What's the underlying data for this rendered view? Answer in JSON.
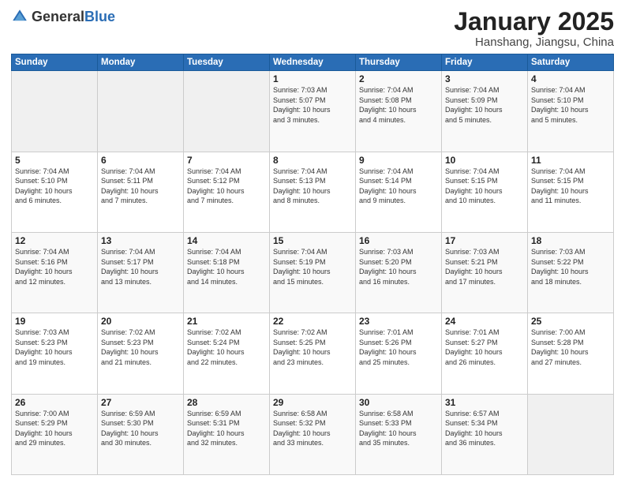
{
  "header": {
    "logo_general": "General",
    "logo_blue": "Blue",
    "month_title": "January 2025",
    "location": "Hanshang, Jiangsu, China"
  },
  "days_of_week": [
    "Sunday",
    "Monday",
    "Tuesday",
    "Wednesday",
    "Thursday",
    "Friday",
    "Saturday"
  ],
  "weeks": [
    [
      {
        "num": "",
        "info": ""
      },
      {
        "num": "",
        "info": ""
      },
      {
        "num": "",
        "info": ""
      },
      {
        "num": "1",
        "info": "Sunrise: 7:03 AM\nSunset: 5:07 PM\nDaylight: 10 hours\nand 3 minutes."
      },
      {
        "num": "2",
        "info": "Sunrise: 7:04 AM\nSunset: 5:08 PM\nDaylight: 10 hours\nand 4 minutes."
      },
      {
        "num": "3",
        "info": "Sunrise: 7:04 AM\nSunset: 5:09 PM\nDaylight: 10 hours\nand 5 minutes."
      },
      {
        "num": "4",
        "info": "Sunrise: 7:04 AM\nSunset: 5:10 PM\nDaylight: 10 hours\nand 5 minutes."
      }
    ],
    [
      {
        "num": "5",
        "info": "Sunrise: 7:04 AM\nSunset: 5:10 PM\nDaylight: 10 hours\nand 6 minutes."
      },
      {
        "num": "6",
        "info": "Sunrise: 7:04 AM\nSunset: 5:11 PM\nDaylight: 10 hours\nand 7 minutes."
      },
      {
        "num": "7",
        "info": "Sunrise: 7:04 AM\nSunset: 5:12 PM\nDaylight: 10 hours\nand 7 minutes."
      },
      {
        "num": "8",
        "info": "Sunrise: 7:04 AM\nSunset: 5:13 PM\nDaylight: 10 hours\nand 8 minutes."
      },
      {
        "num": "9",
        "info": "Sunrise: 7:04 AM\nSunset: 5:14 PM\nDaylight: 10 hours\nand 9 minutes."
      },
      {
        "num": "10",
        "info": "Sunrise: 7:04 AM\nSunset: 5:15 PM\nDaylight: 10 hours\nand 10 minutes."
      },
      {
        "num": "11",
        "info": "Sunrise: 7:04 AM\nSunset: 5:15 PM\nDaylight: 10 hours\nand 11 minutes."
      }
    ],
    [
      {
        "num": "12",
        "info": "Sunrise: 7:04 AM\nSunset: 5:16 PM\nDaylight: 10 hours\nand 12 minutes."
      },
      {
        "num": "13",
        "info": "Sunrise: 7:04 AM\nSunset: 5:17 PM\nDaylight: 10 hours\nand 13 minutes."
      },
      {
        "num": "14",
        "info": "Sunrise: 7:04 AM\nSunset: 5:18 PM\nDaylight: 10 hours\nand 14 minutes."
      },
      {
        "num": "15",
        "info": "Sunrise: 7:04 AM\nSunset: 5:19 PM\nDaylight: 10 hours\nand 15 minutes."
      },
      {
        "num": "16",
        "info": "Sunrise: 7:03 AM\nSunset: 5:20 PM\nDaylight: 10 hours\nand 16 minutes."
      },
      {
        "num": "17",
        "info": "Sunrise: 7:03 AM\nSunset: 5:21 PM\nDaylight: 10 hours\nand 17 minutes."
      },
      {
        "num": "18",
        "info": "Sunrise: 7:03 AM\nSunset: 5:22 PM\nDaylight: 10 hours\nand 18 minutes."
      }
    ],
    [
      {
        "num": "19",
        "info": "Sunrise: 7:03 AM\nSunset: 5:23 PM\nDaylight: 10 hours\nand 19 minutes."
      },
      {
        "num": "20",
        "info": "Sunrise: 7:02 AM\nSunset: 5:23 PM\nDaylight: 10 hours\nand 21 minutes."
      },
      {
        "num": "21",
        "info": "Sunrise: 7:02 AM\nSunset: 5:24 PM\nDaylight: 10 hours\nand 22 minutes."
      },
      {
        "num": "22",
        "info": "Sunrise: 7:02 AM\nSunset: 5:25 PM\nDaylight: 10 hours\nand 23 minutes."
      },
      {
        "num": "23",
        "info": "Sunrise: 7:01 AM\nSunset: 5:26 PM\nDaylight: 10 hours\nand 25 minutes."
      },
      {
        "num": "24",
        "info": "Sunrise: 7:01 AM\nSunset: 5:27 PM\nDaylight: 10 hours\nand 26 minutes."
      },
      {
        "num": "25",
        "info": "Sunrise: 7:00 AM\nSunset: 5:28 PM\nDaylight: 10 hours\nand 27 minutes."
      }
    ],
    [
      {
        "num": "26",
        "info": "Sunrise: 7:00 AM\nSunset: 5:29 PM\nDaylight: 10 hours\nand 29 minutes."
      },
      {
        "num": "27",
        "info": "Sunrise: 6:59 AM\nSunset: 5:30 PM\nDaylight: 10 hours\nand 30 minutes."
      },
      {
        "num": "28",
        "info": "Sunrise: 6:59 AM\nSunset: 5:31 PM\nDaylight: 10 hours\nand 32 minutes."
      },
      {
        "num": "29",
        "info": "Sunrise: 6:58 AM\nSunset: 5:32 PM\nDaylight: 10 hours\nand 33 minutes."
      },
      {
        "num": "30",
        "info": "Sunrise: 6:58 AM\nSunset: 5:33 PM\nDaylight: 10 hours\nand 35 minutes."
      },
      {
        "num": "31",
        "info": "Sunrise: 6:57 AM\nSunset: 5:34 PM\nDaylight: 10 hours\nand 36 minutes."
      },
      {
        "num": "",
        "info": ""
      }
    ]
  ]
}
